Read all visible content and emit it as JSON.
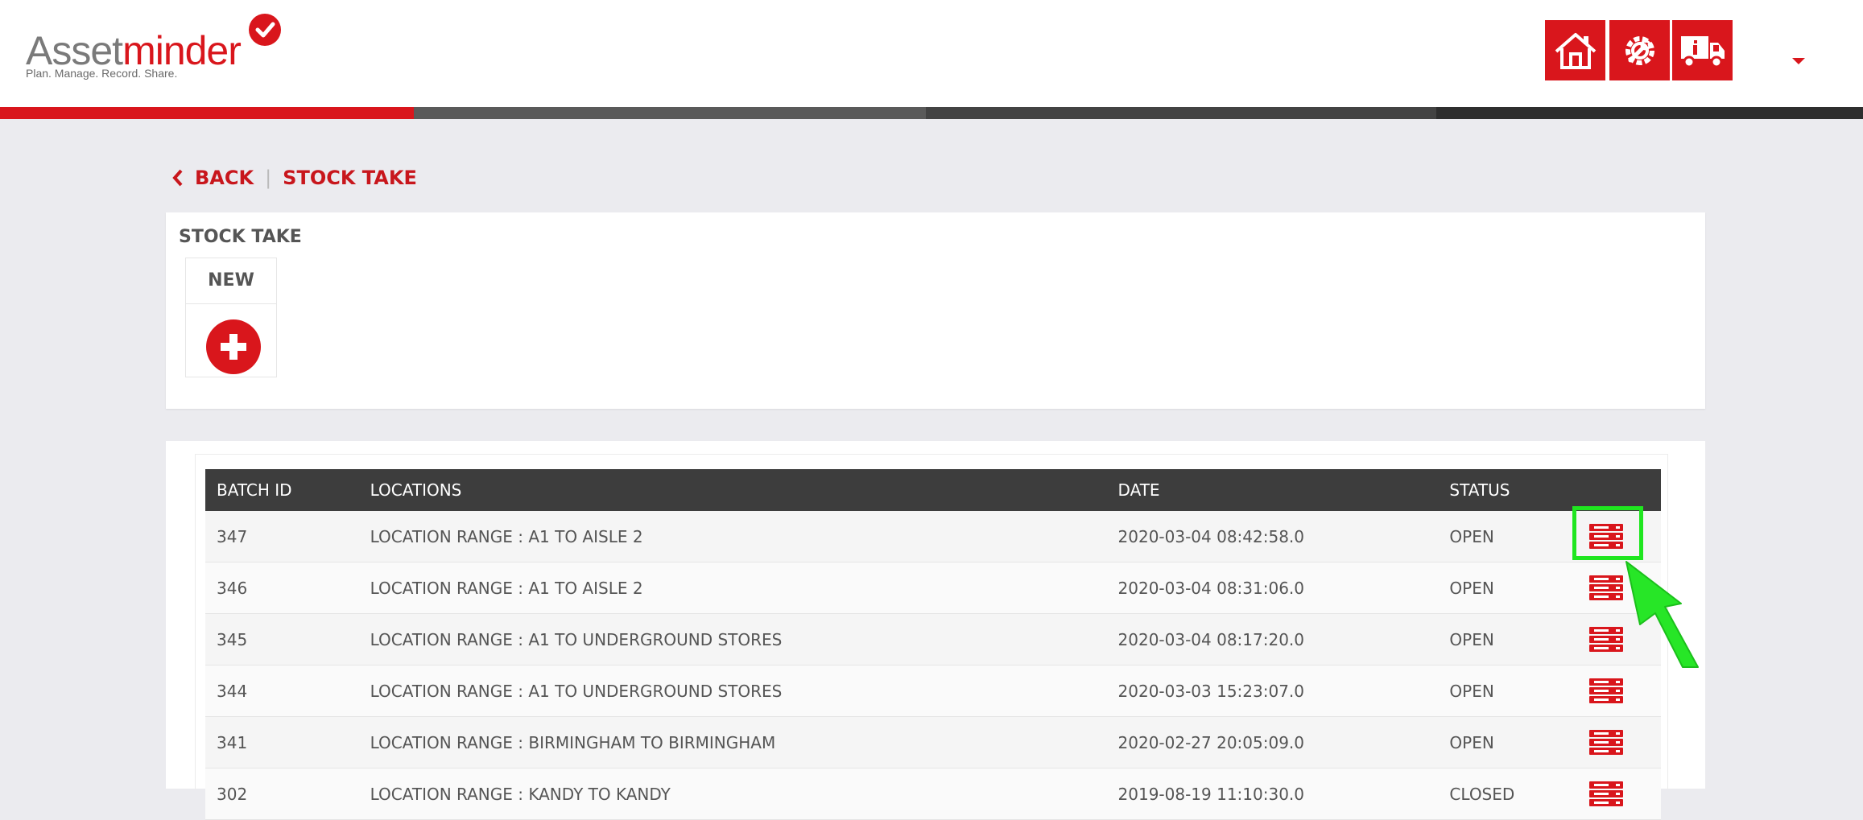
{
  "header": {
    "logo": {
      "part1": "Asset",
      "part2": "minder",
      "tagline": "Plan. Manage. Record. Share."
    },
    "buttons": [
      {
        "icon": "home-icon"
      },
      {
        "icon": "gear-wrench-icon"
      },
      {
        "icon": "truck-info-icon"
      }
    ],
    "colors": {
      "brand": "#d9161c",
      "bar_dark": "#3d3d3d"
    }
  },
  "breadcrumb": {
    "back": "BACK",
    "current": "STOCK TAKE"
  },
  "stock_take_panel": {
    "title": "STOCK TAKE",
    "new_label": "NEW"
  },
  "table": {
    "columns": [
      "BATCH ID",
      "LOCATIONS",
      "DATE",
      "STATUS",
      ""
    ],
    "rows": [
      {
        "batch_id": "347",
        "location": "LOCATION RANGE : A1 TO AISLE 2",
        "date": "2020-03-04 08:42:58.0",
        "status": "OPEN"
      },
      {
        "batch_id": "346",
        "location": "LOCATION RANGE : A1 TO AISLE 2",
        "date": "2020-03-04 08:31:06.0",
        "status": "OPEN"
      },
      {
        "batch_id": "345",
        "location": "LOCATION RANGE : A1 TO UNDERGROUND STORES",
        "date": "2020-03-04 08:17:20.0",
        "status": "OPEN"
      },
      {
        "batch_id": "344",
        "location": "LOCATION RANGE : A1 TO UNDERGROUND STORES",
        "date": "2020-03-03 15:23:07.0",
        "status": "OPEN"
      },
      {
        "batch_id": "341",
        "location": "LOCATION RANGE : BIRMINGHAM TO BIRMINGHAM",
        "date": "2020-02-27 20:05:09.0",
        "status": "OPEN"
      },
      {
        "batch_id": "302",
        "location": "LOCATION RANGE : KANDY TO KANDY",
        "date": "2019-08-19 11:10:30.0",
        "status": "CLOSED"
      }
    ]
  }
}
